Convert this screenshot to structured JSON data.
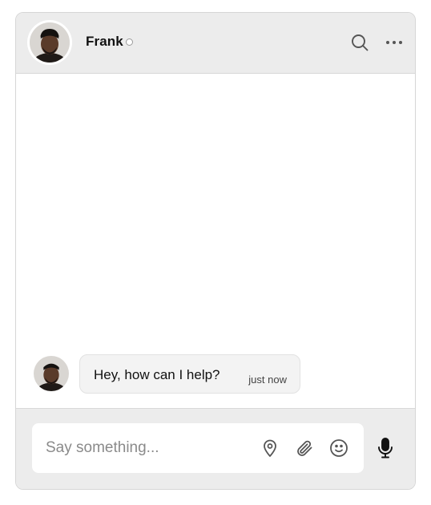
{
  "header": {
    "contact_name": "Frank",
    "status": "offline",
    "search_icon": "search-icon",
    "more_icon": "more-horizontal-icon"
  },
  "messages": [
    {
      "sender": "Frank",
      "text": "Hey, how can I help?",
      "time": "just now"
    }
  ],
  "composer": {
    "placeholder": "Say something...",
    "value": "",
    "icons": [
      "location-pin-icon",
      "paperclip-icon",
      "emoji-icon",
      "microphone-icon"
    ]
  },
  "colors": {
    "header_bg": "#ececec",
    "bubble_bg": "#f3f3f3",
    "border": "#d6d6d6",
    "icon": "#555555"
  }
}
